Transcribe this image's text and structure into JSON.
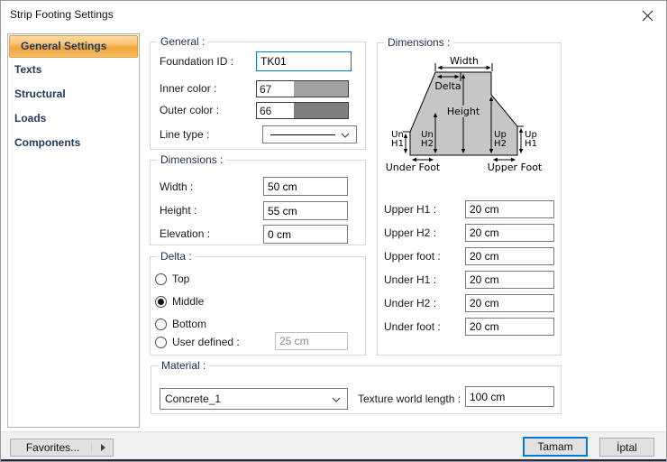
{
  "window": {
    "title": "Strip Footing Settings"
  },
  "sidebar": {
    "items": [
      {
        "label": "General Settings",
        "selected": true
      },
      {
        "label": "Texts",
        "selected": false
      },
      {
        "label": "Structural",
        "selected": false
      },
      {
        "label": "Loads",
        "selected": false
      },
      {
        "label": "Components",
        "selected": false
      }
    ]
  },
  "general_group": {
    "title": "General :",
    "foundation_id_label": "Foundation ID :",
    "foundation_id_value": "TK01",
    "inner_color_label": "Inner color :",
    "inner_color_value": "67",
    "inner_color_swatch": "#a1a1a1",
    "outer_color_label": "Outer color :",
    "outer_color_value": "66",
    "outer_color_swatch": "#7f7f7f",
    "line_type_label": "Line type :"
  },
  "dimensions_group": {
    "title": "Dimensions :",
    "width_label": "Width :",
    "width_value": "50 cm",
    "height_label": "Height :",
    "height_value": "55 cm",
    "elevation_label": "Elevation :",
    "elevation_value": "0 cm"
  },
  "delta_group": {
    "title": "Delta :",
    "options": [
      {
        "label": "Top",
        "selected": false
      },
      {
        "label": "Middle",
        "selected": true
      },
      {
        "label": "Bottom",
        "selected": false
      },
      {
        "label": "User defined :",
        "selected": false
      }
    ],
    "user_defined_value": "25 cm"
  },
  "material_group": {
    "title": "Material :",
    "material_value": "Concrete_1",
    "texture_label": "Texture world length :",
    "texture_value": "100 cm"
  },
  "right_dimensions_group": {
    "title": "Dimensions :",
    "diagram": {
      "width": "Width",
      "delta": "Delta",
      "height": "Height",
      "un": "Un",
      "up": "Up",
      "h1": "H1",
      "h2": "H2",
      "under_foot": "Under Foot",
      "upper_foot": "Upper Foot",
      "fill": "#c6c6c6"
    },
    "fields": [
      {
        "label": "Upper H1 :",
        "value": "20 cm"
      },
      {
        "label": "Upper H2 :",
        "value": "20 cm"
      },
      {
        "label": "Upper foot :",
        "value": "20 cm"
      },
      {
        "label": "Under H1 :",
        "value": "20 cm"
      },
      {
        "label": "Under H2 :",
        "value": "20 cm"
      },
      {
        "label": "Under foot :",
        "value": "20 cm"
      }
    ]
  },
  "footer": {
    "favorites_label": "Favorites...",
    "ok_label": "Tamam",
    "cancel_label": "İptal"
  },
  "colors": {
    "accent": "#0078d7",
    "selected_item_border": "#dfa03f",
    "selected_item_gradient_top": "#fcd9a2",
    "selected_item_gradient_bottom": "#f8bf67",
    "sidebar_text": "#1e395b",
    "footer_bg": "#f0f0f0",
    "diagram_fill": "#c6c6c6"
  }
}
